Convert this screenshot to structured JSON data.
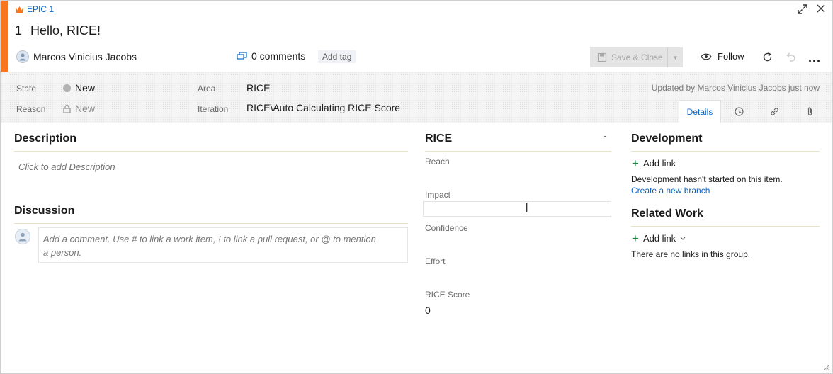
{
  "work_item": {
    "type_label": "EPIC 1",
    "id": "1",
    "title": "Hello, RICE!",
    "assignee": "Marcos Vinicius Jacobs",
    "comments_label": "0 comments",
    "add_tag_label": "Add tag",
    "accent_color": "#f7761e"
  },
  "toolbar": {
    "save_close_label": "Save & Close",
    "follow_label": "Follow",
    "more_label": "..."
  },
  "fields": {
    "state_label": "State",
    "state_value": "New",
    "reason_label": "Reason",
    "reason_value": "New",
    "area_label": "Area",
    "area_value": "RICE",
    "iteration_label": "Iteration",
    "iteration_value": "RICE\\Auto Calculating RICE Score",
    "updated_text": "Updated by Marcos Vinicius Jacobs just now"
  },
  "tabs": {
    "details_label": "Details",
    "history_icon": "history-icon",
    "links_icon": "link-icon",
    "attachments_icon": "paperclip-icon"
  },
  "description": {
    "title": "Description",
    "placeholder": "Click to add Description"
  },
  "discussion": {
    "title": "Discussion",
    "placeholder_line1": "Add a comment. Use # to link a work item, ! to link a pull request, or @ to mention",
    "placeholder_line2": "a person."
  },
  "rice": {
    "title": "RICE",
    "reach_label": "Reach",
    "impact_label": "Impact",
    "confidence_label": "Confidence",
    "effort_label": "Effort",
    "score_label": "RICE Score",
    "score_value": "0"
  },
  "development": {
    "title": "Development",
    "add_link_label": "Add link",
    "status_text": "Development hasn't started on this item.",
    "create_branch_label": "Create a new branch"
  },
  "related_work": {
    "title": "Related Work",
    "add_link_label": "Add link",
    "empty_text": "There are no links in this group."
  }
}
